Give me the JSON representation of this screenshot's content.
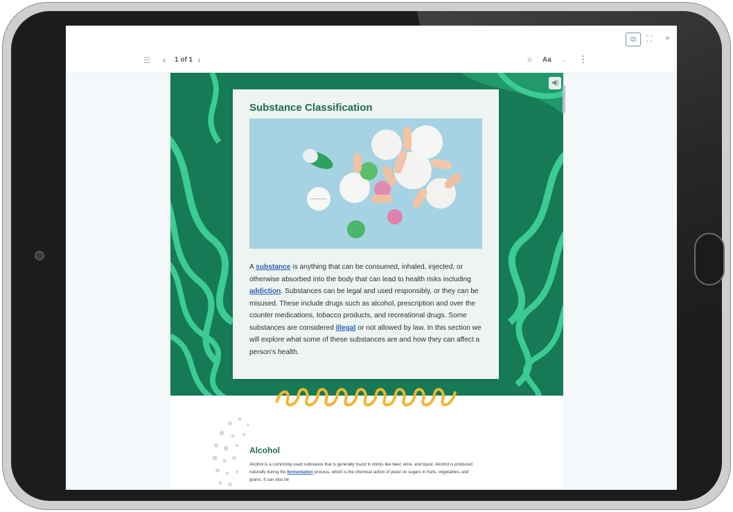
{
  "topbar": {
    "popout_icon": "popout-window-icon",
    "expand_icon": "expand-icon",
    "close_label": "×"
  },
  "toolbar": {
    "toc_icon": "table-of-contents-icon",
    "prev_icon": "chevron-left-icon",
    "page_count": "1 of 1",
    "next_icon": "chevron-right-icon",
    "search_icon": "search-icon",
    "font_label": "Aa",
    "back_icon": "arrow-left-icon",
    "more_icon": "more-vertical-icon"
  },
  "page": {
    "audio_icon": "speaker-icon",
    "card": {
      "title": "Substance Classification",
      "photo_subject": "pills-on-blue-background",
      "paragraph": {
        "t1": "A ",
        "link1": "substance",
        "t2": " is anything that can be consumed, inhaled, injected, or otherwise absorbed into the body that can lead to health risks including ",
        "link2": "addiction",
        "t3": ". Substances can be legal and used responsibly, or they can be misused. These include drugs such as alcohol, prescription and over the counter medications, tobacco products, and recreational drugs. Some substances are considered ",
        "link3": "illegal",
        "t4": " or not allowed by law. In this section we will explore what some of these substances are and how they can affect a person's health."
      }
    },
    "section": {
      "title": "Alcohol",
      "t1": "Alcohol is a commonly used substance that is generally found in drinks like beer, wine, and liquor. Alcohol is produced naturally during the ",
      "link1": "fermentation",
      "t2": " process, which is the chemical action of yeast on sugars in fruits, vegetables, and grains. It can also be"
    }
  },
  "colors": {
    "hero_green": "#167a57",
    "accent_green": "#1f6b4d",
    "wave_green": "#3ccb94",
    "link_blue": "#2d5fb4",
    "swirl_yellow": "#f2b52c"
  }
}
